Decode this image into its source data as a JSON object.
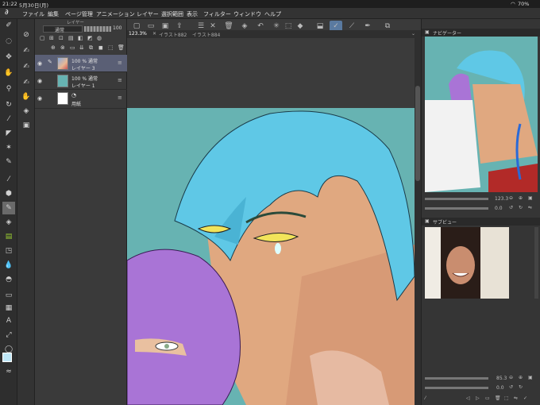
{
  "status": {
    "time": "21:22",
    "date": "5月30日(月)",
    "battery": "70%"
  },
  "menu": [
    "ファイル",
    "編集",
    "ページ管理",
    "アニメーション",
    "レイヤー",
    "選択範囲",
    "表示",
    "フィルター",
    "ウィンドウ",
    "ヘルプ"
  ],
  "layer_panel": {
    "title": "レイヤー",
    "blend_mode": "通常",
    "opacity": "100",
    "layers": [
      {
        "pct": "100 %",
        "mode": "通常",
        "name": "レイヤー 3"
      },
      {
        "pct": "100 %",
        "mode": "通常",
        "name": "レイヤー 1"
      },
      {
        "pct": "",
        "mode": "",
        "name": "用紙"
      }
    ]
  },
  "doc_tabs": [
    "123.3%",
    "イラスト882",
    "イラスト884"
  ],
  "navigator": {
    "title": "ナビゲーター",
    "zoom": "123.3",
    "angle": "0.0"
  },
  "subview": {
    "title": "サブビュー",
    "zoom": "85.3",
    "angle": "0.0"
  },
  "colors": {
    "bg": "#2b2b2b",
    "selected_layer": "#5a5f75",
    "artwork_bg": "#67b3b2",
    "hair_blue": "#5fc8e6",
    "hair_purple": "#a974d6"
  }
}
